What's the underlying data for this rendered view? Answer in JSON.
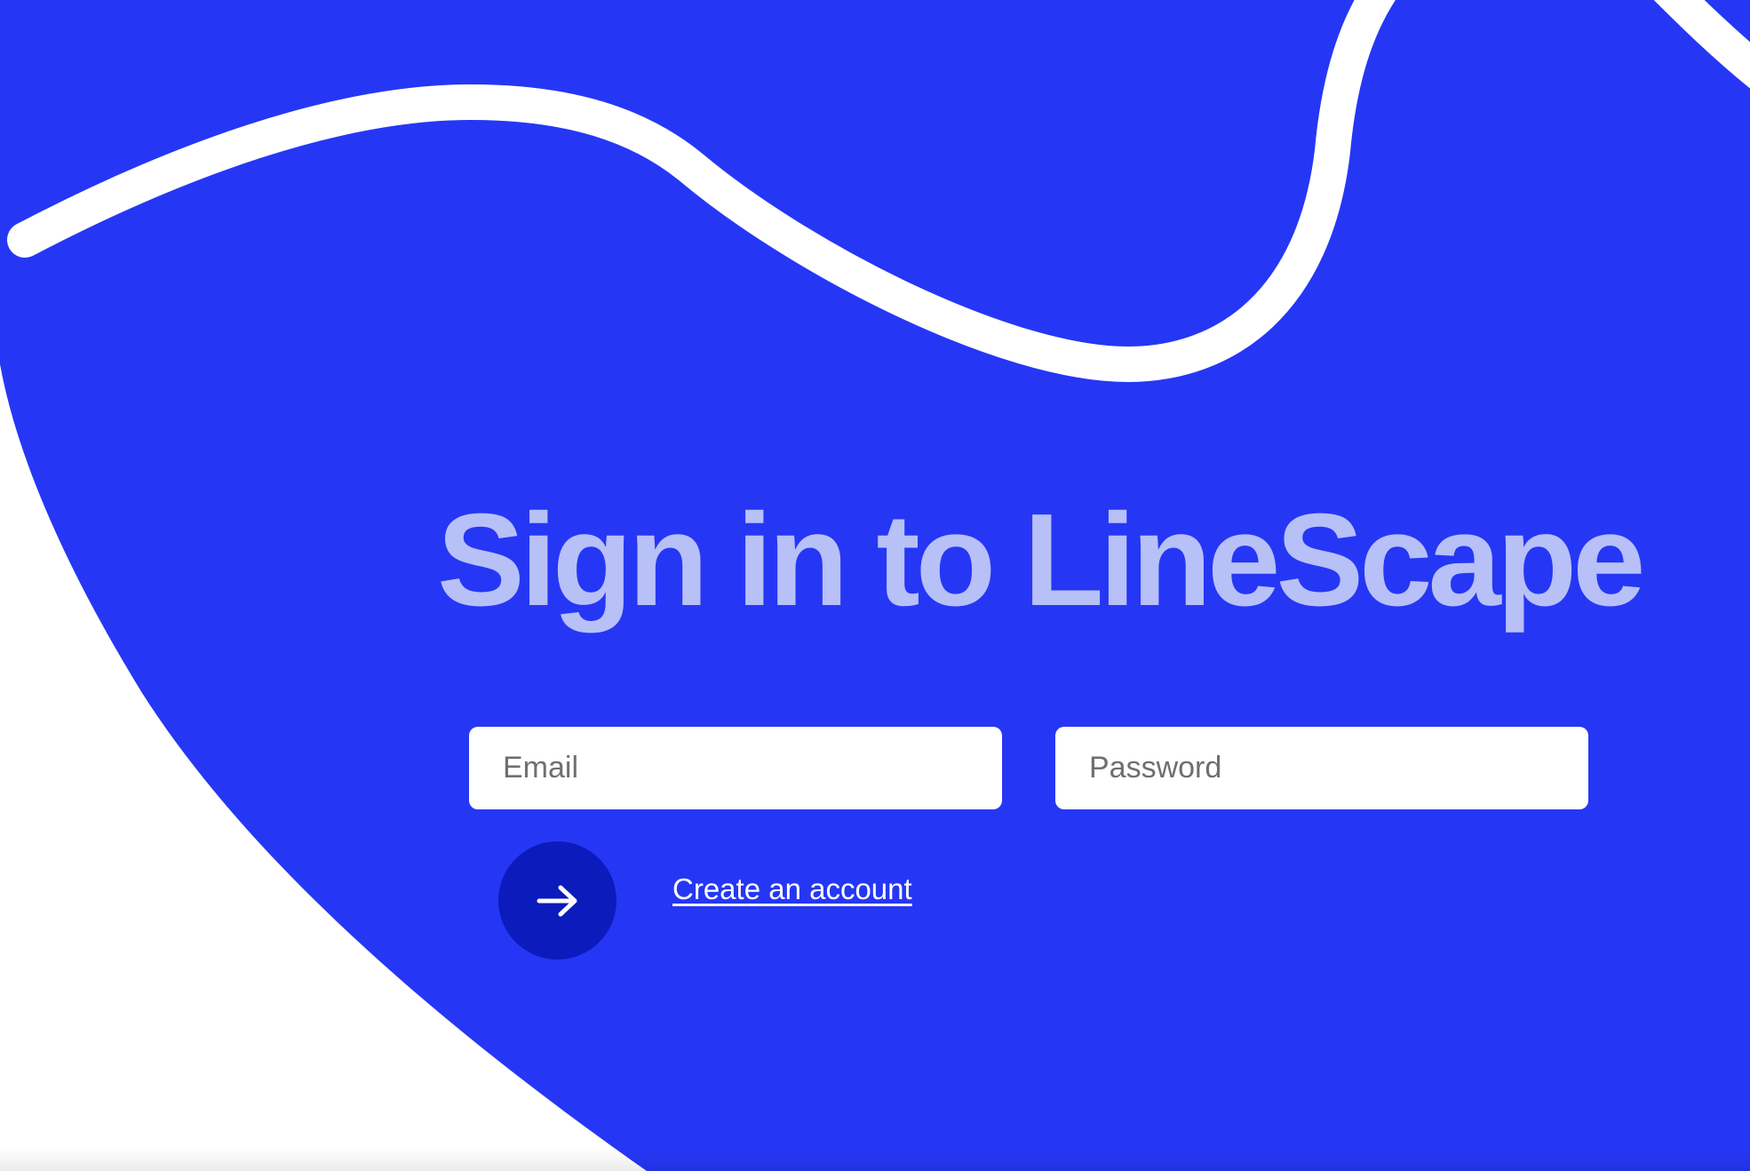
{
  "colors": {
    "background": "#ffffff",
    "accent_blue": "#2537f5",
    "swoosh": "#ffffff",
    "title_text": "#b8c0f8",
    "submit_button": "#0c1cbc",
    "link_text": "#ffffff"
  },
  "signin": {
    "title": "Sign in to LineScape",
    "email_placeholder": "Email",
    "password_placeholder": "Password",
    "submit_icon": "arrow-right-icon",
    "create_account_label": "Create an account"
  }
}
